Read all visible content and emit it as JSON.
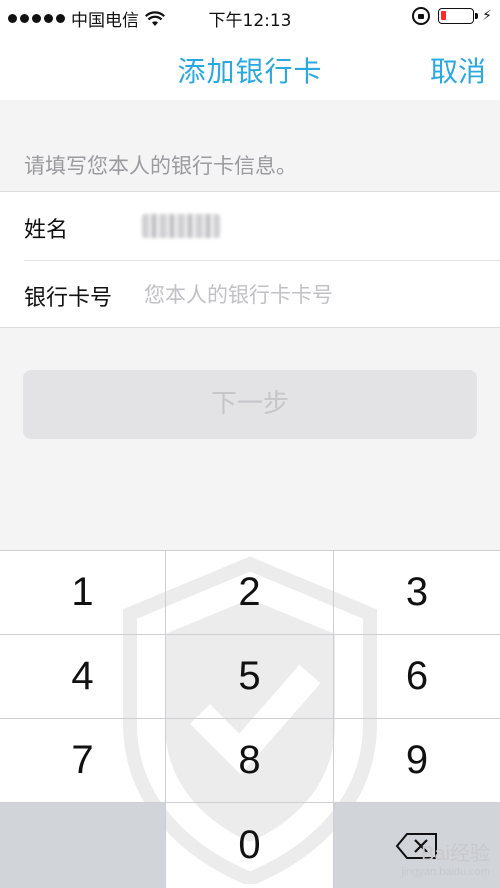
{
  "status_bar": {
    "carrier": "中国电信",
    "time": "下午12:13"
  },
  "nav": {
    "title": "添加银行卡",
    "cancel_label": "取消",
    "accent_color": "#2aa8e0"
  },
  "form": {
    "hint": "请填写您本人的银行卡信息。",
    "name_label": "姓名",
    "card_label": "银行卡号",
    "card_placeholder": "您本人的银行卡卡号",
    "card_value": ""
  },
  "next_button_label": "下一步",
  "keypad": {
    "keys": [
      "1",
      "2",
      "3",
      "4",
      "5",
      "6",
      "7",
      "8",
      "9",
      "0"
    ],
    "delete_icon": "backspace-icon"
  },
  "watermark": {
    "brand": "Bai经验",
    "url": "jingyan.baidu.com"
  }
}
